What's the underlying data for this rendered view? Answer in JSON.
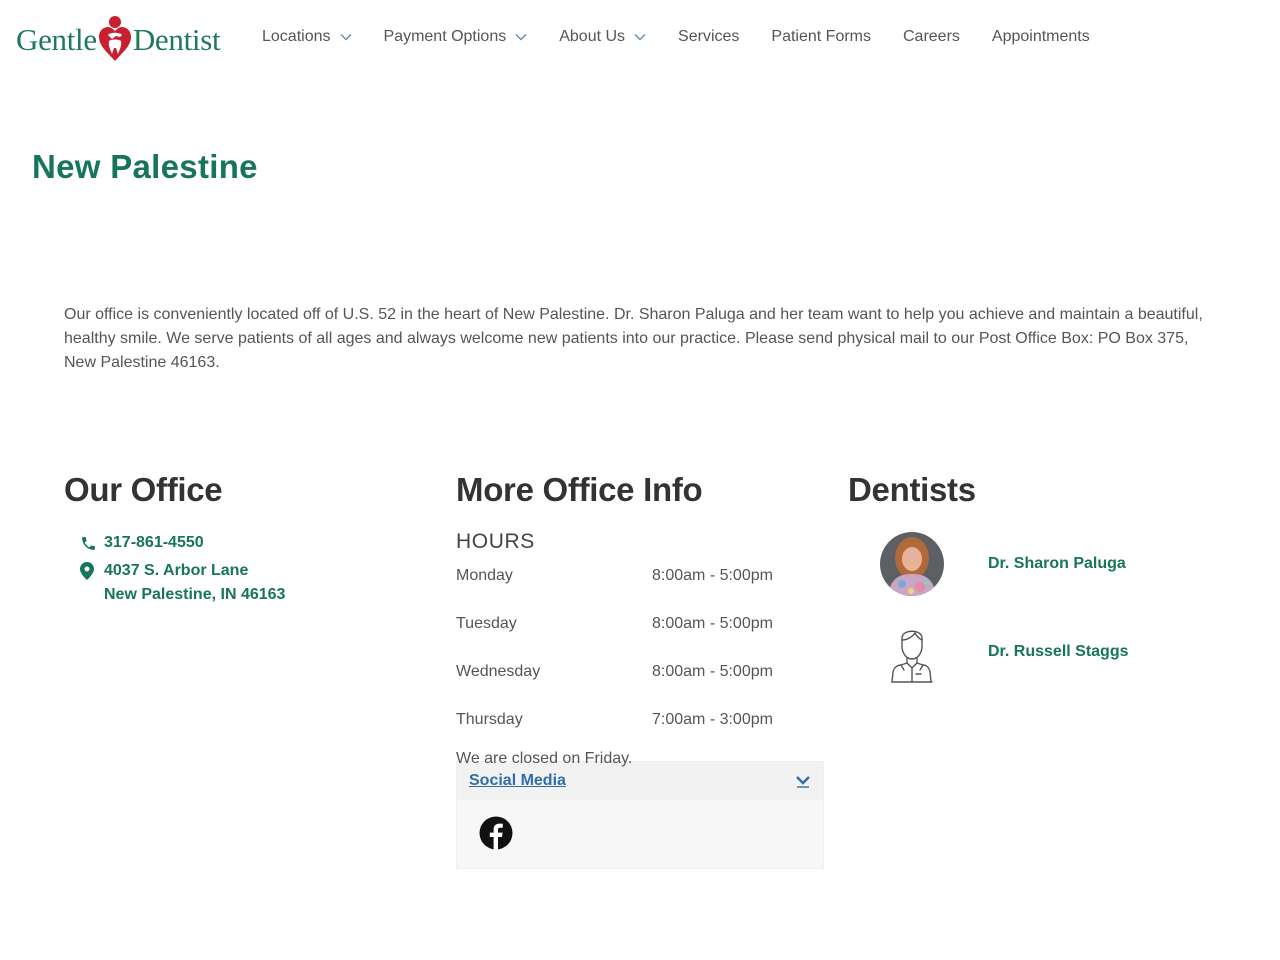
{
  "brand": {
    "logo_left": "Gentle",
    "logo_right": "Dentist",
    "primary_green": "#17755a",
    "logo_red": "#c8202e",
    "link_blue": "#2f6ea8"
  },
  "nav": {
    "items": [
      {
        "label": "Locations",
        "has_dropdown": true
      },
      {
        "label": "Payment Options",
        "has_dropdown": true
      },
      {
        "label": "About Us",
        "has_dropdown": true
      },
      {
        "label": "Services",
        "has_dropdown": false
      },
      {
        "label": "Patient Forms",
        "has_dropdown": false
      },
      {
        "label": "Careers",
        "has_dropdown": false
      },
      {
        "label": "Appointments",
        "has_dropdown": false
      }
    ]
  },
  "page": {
    "title": "New Palestine",
    "intro": "Our office is conveniently located off of U.S. 52 in the heart of New Palestine. Dr. Sharon Paluga and her team want to help you achieve and maintain a beautiful, healthy smile. We serve patients of all ages and always welcome new patients into our practice. Please send physical mail to our Post Office Box: PO Box 375, New Palestine 46163."
  },
  "office": {
    "heading": "Our Office",
    "phone_icon": "phone-icon",
    "phone": "317-861-4550",
    "address_icon": "map-pin-icon",
    "address_line1": "4037 S. Arbor Lane",
    "address_line2": "New Palestine, IN 46163"
  },
  "info": {
    "heading": "More Office Info",
    "hours_label": "HOURS",
    "hours": [
      {
        "day": "Monday",
        "time": "8:00am - 5:00pm"
      },
      {
        "day": "Tuesday",
        "time": "8:00am - 5:00pm"
      },
      {
        "day": "Wednesday",
        "time": "8:00am - 5:00pm"
      },
      {
        "day": "Thursday",
        "time": "7:00am - 3:00pm"
      }
    ],
    "closed_note": "We are closed on Friday.",
    "social": {
      "title": "Social Media",
      "toggle_icon": "chevron-down-icon",
      "links": [
        {
          "icon": "facebook-icon"
        }
      ]
    }
  },
  "dentists": {
    "heading": "Dentists",
    "items": [
      {
        "name": "Dr. Sharon Paluga",
        "avatar": "photo"
      },
      {
        "name": "Dr. Russell Staggs",
        "avatar": "person-outline-icon"
      }
    ]
  }
}
